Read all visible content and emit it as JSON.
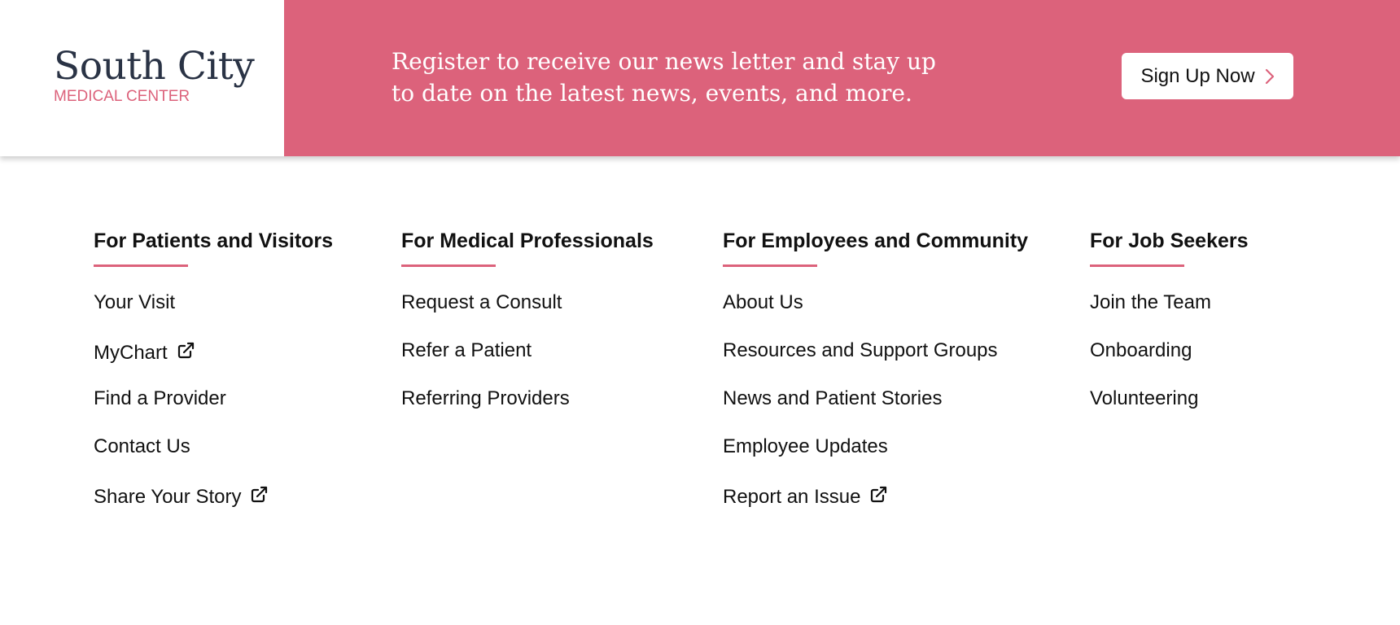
{
  "logo": {
    "title": "South City",
    "subtitle": "MEDICAL CENTER"
  },
  "promo": {
    "line1": "Register to receive our news letter and stay up",
    "line2": "to date on the latest news, events, and more.",
    "button_label": "Sign Up Now",
    "button_icon": "chevron-right-icon"
  },
  "colors": {
    "accent": "#dc627b",
    "logo_dark": "#2a3345",
    "text": "#111111",
    "background": "#ffffff"
  },
  "columns": [
    {
      "heading": "For Patients and Visitors",
      "links": [
        {
          "label": "Your Visit",
          "external": false
        },
        {
          "label": "MyChart",
          "external": true
        },
        {
          "label": "Find a Provider",
          "external": false
        },
        {
          "label": "Contact Us",
          "external": false
        },
        {
          "label": "Share Your Story",
          "external": true
        }
      ]
    },
    {
      "heading": "For Medical Professionals",
      "links": [
        {
          "label": "Request a Consult",
          "external": false
        },
        {
          "label": "Refer a Patient",
          "external": false
        },
        {
          "label": "Referring Providers",
          "external": false
        }
      ]
    },
    {
      "heading": "For Employees and Community",
      "links": [
        {
          "label": "About Us",
          "external": false
        },
        {
          "label": "Resources and Support Groups",
          "external": false
        },
        {
          "label": "News and Patient Stories",
          "external": false
        },
        {
          "label": "Employee Updates",
          "external": false
        },
        {
          "label": "Report an Issue",
          "external": true
        }
      ]
    },
    {
      "heading": "For Job Seekers",
      "links": [
        {
          "label": "Join the Team",
          "external": false
        },
        {
          "label": "Onboarding",
          "external": false
        },
        {
          "label": "Volunteering",
          "external": false
        }
      ]
    }
  ]
}
